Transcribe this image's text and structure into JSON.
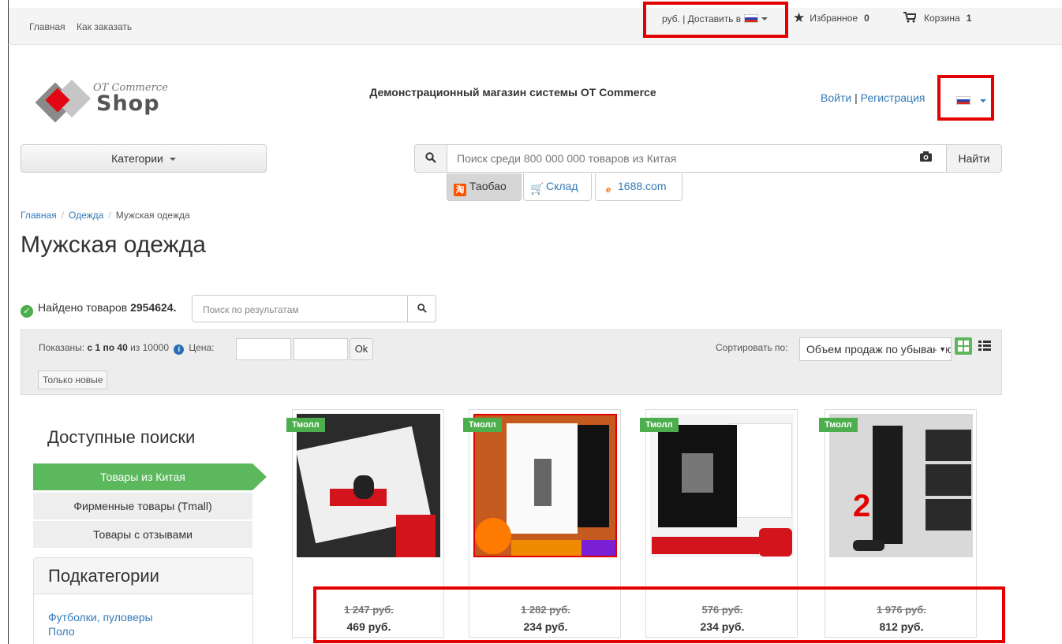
{
  "topnav": {
    "home": "Главная",
    "how_to_order": "Как заказать"
  },
  "delivery": {
    "label": "руб. | Доставить в"
  },
  "favorites": {
    "label": "Избранное",
    "count": "0"
  },
  "cart": {
    "label": "Корзина",
    "count": "1"
  },
  "logo": {
    "line1": "OT Commerce",
    "line2": "Shop"
  },
  "store_title": "Демонстрационный магазин системы OT Commerce",
  "auth": {
    "login": "Войти",
    "sep": " | ",
    "register": "Регистрация"
  },
  "categories_button": "Категории",
  "search": {
    "placeholder": "Поиск среди 800 000 000 товаров из Китая",
    "button": "Найти"
  },
  "providers": [
    {
      "label": "Таобао",
      "icon": "taobao-icon"
    },
    {
      "label": "Склад",
      "icon": "warehouse-icon"
    },
    {
      "label": "1688.com",
      "icon": "1688-icon"
    }
  ],
  "breadcrumb": [
    "Главная",
    "Одежда",
    "Мужская одежда"
  ],
  "page_title": "Мужская одежда",
  "found": {
    "prefix": "Найдено товаров",
    "count": "2954624."
  },
  "result_search": {
    "placeholder": "Поиск по результатам"
  },
  "filters": {
    "shown_prefix": "Показаны:",
    "shown_range": "с 1 по 40",
    "shown_total": "из 10000",
    "price_label": "Цена:",
    "ok": "Ok",
    "only_new": "Только новые",
    "sort_label": "Сортировать по:",
    "sort_value": "Объем продаж по убыванию"
  },
  "sidebar": {
    "title": "Доступные поиски",
    "items": [
      "Товары из Китая",
      "Фирменные товары (Tmall)",
      "Товары с отзывами"
    ],
    "subcategories_title": "Подкатегории",
    "subcategories": [
      "Футболки, пуловеры",
      "Поло"
    ]
  },
  "products": [
    {
      "badge": "Тмолл",
      "old_price": "1 247 руб.",
      "price": "469 руб."
    },
    {
      "badge": "Тмолл",
      "old_price": "1 282 руб.",
      "price": "234 руб."
    },
    {
      "badge": "Тмолл",
      "old_price": "576 руб.",
      "price": "234 руб."
    },
    {
      "badge": "Тмолл",
      "old_price": "1 976 руб.",
      "price": "812 руб."
    }
  ],
  "colors": {
    "accent_green": "#5cb85c",
    "highlight_red": "#e30000",
    "link": "#337ab7"
  }
}
